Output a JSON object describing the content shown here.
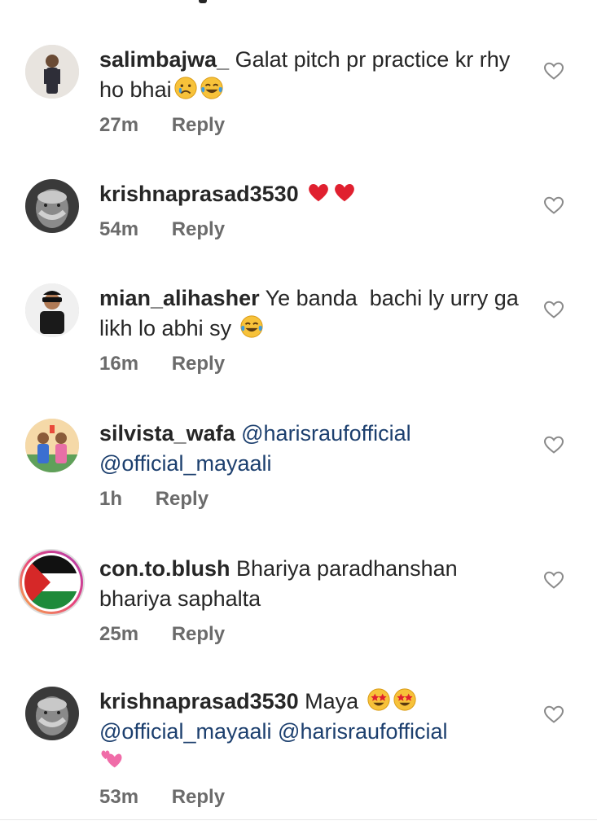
{
  "comments": [
    {
      "username": "salimbajwa_",
      "text": "Galat pitch pr practice kr rhy ho bhai",
      "emojis": [
        "crying-face",
        "tears-of-joy"
      ],
      "time": "27m",
      "reply": "Reply"
    },
    {
      "username": "krishnaprasad3530",
      "text": "",
      "emojis": [
        "red-heart",
        "red-heart"
      ],
      "time": "54m",
      "reply": "Reply"
    },
    {
      "username": "mian_alihasher",
      "text": "Ye banda  bachi ly urry ga likh lo abhi sy",
      "emojis": [
        "tears-of-joy"
      ],
      "time": "16m",
      "reply": "Reply"
    },
    {
      "username": "silvista_wafa",
      "mention1": "@harisraufofficial",
      "mention2": "@official_mayaali",
      "time": "1h",
      "reply": "Reply"
    },
    {
      "username": "con.to.blush",
      "text": "Bhariya paradhanshan bhariya saphalta",
      "time": "25m",
      "reply": "Reply"
    },
    {
      "username": "krishnaprasad3530",
      "text": "Maya",
      "emojis": [
        "star-struck",
        "star-struck",
        "two-hearts"
      ],
      "mention1": "@official_mayaali",
      "mention2": "@harisraufofficial",
      "time": "53m",
      "reply": "Reply"
    }
  ],
  "colors": {
    "text": "#262626",
    "meta": "#6b6b6b",
    "mention": "#1c3f6e",
    "heart": "#e0245e"
  }
}
